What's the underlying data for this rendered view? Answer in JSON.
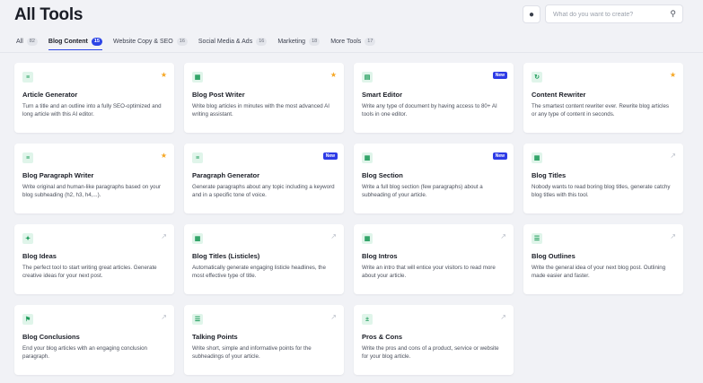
{
  "header": {
    "title": "All Tools",
    "idea_icon": "bulb-icon",
    "search": {
      "placeholder": "What do you want to create?",
      "value": "",
      "icon": "search-icon"
    }
  },
  "tabs": [
    {
      "label": "All",
      "count": "82",
      "active": false
    },
    {
      "label": "Blog Content",
      "count": "15",
      "active": true
    },
    {
      "label": "Website Copy & SEO",
      "count": "16",
      "active": false
    },
    {
      "label": "Social Media & Ads",
      "count": "16",
      "active": false
    },
    {
      "label": "Marketing",
      "count": "18",
      "active": false
    },
    {
      "label": "More Tools",
      "count": "17",
      "active": false
    }
  ],
  "colors": {
    "accent": "#2d45e6",
    "star": "#f5a623",
    "icon_green": "#1e9b5a",
    "icon_bg": "#e0f5ea"
  },
  "cards": [
    {
      "title": "Article Generator",
      "desc": "Turn a title and an outline into a fully SEO-optimized and long article with this AI editor.",
      "icon": "article-icon",
      "glyph": "≡",
      "marker": "star"
    },
    {
      "title": "Blog Post Writer",
      "desc": "Write blog articles in minutes with the most advanced AI writing assistant.",
      "icon": "blog-post-icon",
      "glyph": "▦",
      "marker": "star"
    },
    {
      "title": "Smart Editor",
      "desc": "Write any type of document by having access to 80+ AI tools in one editor.",
      "icon": "document-icon",
      "glyph": "▤",
      "marker": "new",
      "marker_label": "New"
    },
    {
      "title": "Content Rewriter",
      "desc": "The smartest content rewriter ever. Rewrite blog articles or any type of content in seconds.",
      "icon": "rewrite-icon",
      "glyph": "↻",
      "marker": "star"
    },
    {
      "title": "Blog Paragraph Writer",
      "desc": "Write original and human-like paragraphs based on your blog subheading (h2, h3, h4,...).",
      "icon": "paragraph-icon",
      "glyph": "≡",
      "marker": "star"
    },
    {
      "title": "Paragraph Generator",
      "desc": "Generate paragraphs about any topic including a keyword and in a specific tone of voice.",
      "icon": "paragraph-generator-icon",
      "glyph": "≡",
      "marker": "new",
      "marker_label": "New"
    },
    {
      "title": "Blog Section",
      "desc": "Write a full blog section (few paragraphs) about a subheading of your article.",
      "icon": "section-icon",
      "glyph": "▦",
      "marker": "new",
      "marker_label": "New"
    },
    {
      "title": "Blog Titles",
      "desc": "Nobody wants to read boring blog titles, generate catchy blog titles with this tool.",
      "icon": "titles-icon",
      "glyph": "▦",
      "marker": "arrow"
    },
    {
      "title": "Blog Ideas",
      "desc": "The perfect tool to start writing great articles. Generate creative ideas for your next post.",
      "icon": "lightbulb-icon",
      "glyph": "✦",
      "marker": "arrow"
    },
    {
      "title": "Blog Titles (Listicles)",
      "desc": "Automatically generate engaging listicle headlines, the most effective type of title.",
      "icon": "listicle-icon",
      "glyph": "▦",
      "marker": "arrow"
    },
    {
      "title": "Blog Intros",
      "desc": "Write an intro that will entice your visitors to read more about your article.",
      "icon": "intro-icon",
      "glyph": "▦",
      "marker": "arrow"
    },
    {
      "title": "Blog Outlines",
      "desc": "Write the general idea of your next blog post. Outlining made easier and faster.",
      "icon": "outline-icon",
      "glyph": "☰",
      "marker": "arrow"
    },
    {
      "title": "Blog Conclusions",
      "desc": "End your blog articles with an engaging conclusion paragraph.",
      "icon": "flag-icon",
      "glyph": "⚑",
      "marker": "arrow"
    },
    {
      "title": "Talking Points",
      "desc": "Write short, simple and informative points for the subheadings of your article.",
      "icon": "list-icon",
      "glyph": "☰",
      "marker": "arrow"
    },
    {
      "title": "Pros & Cons",
      "desc": "Write the pros and cons of a product, service or website for your blog article.",
      "icon": "pros-cons-icon",
      "glyph": "±",
      "marker": "arrow"
    }
  ]
}
